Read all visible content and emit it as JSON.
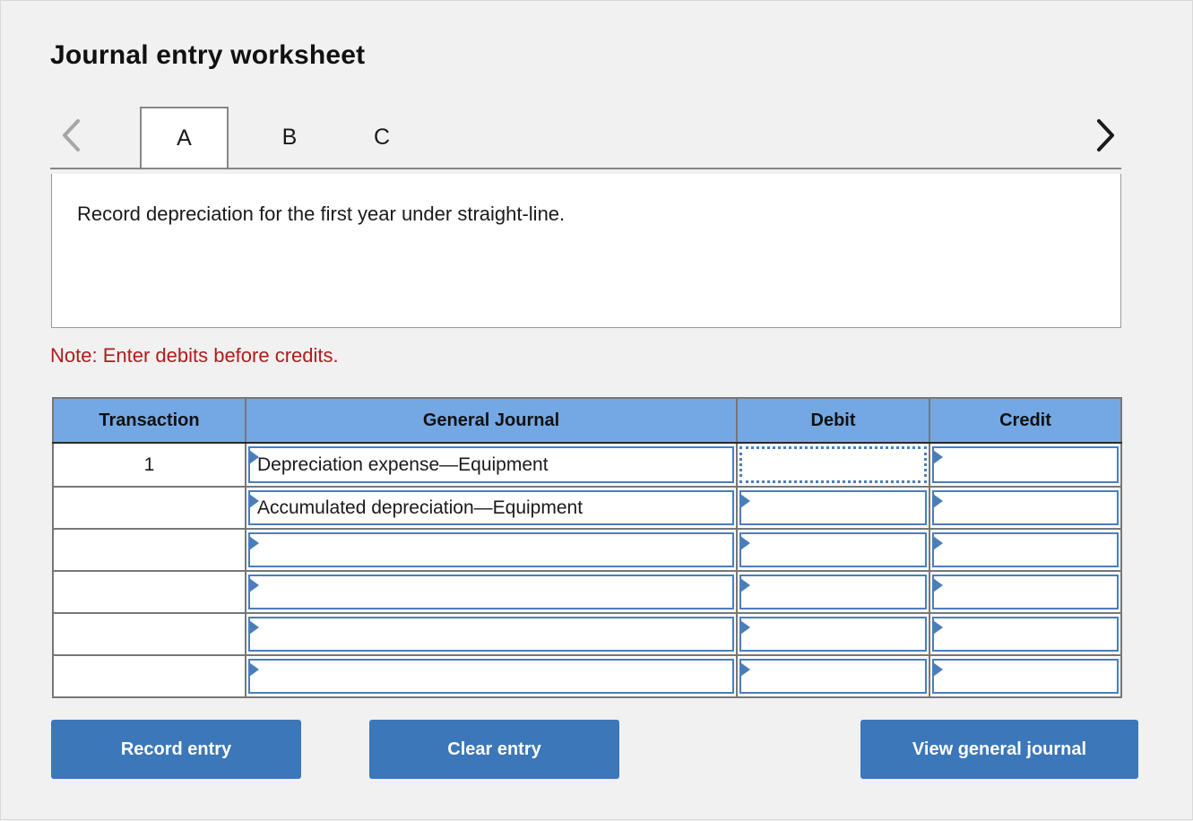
{
  "page": {
    "title": "Journal entry worksheet",
    "background_color": "#f1f1f1"
  },
  "tabs": {
    "prev_label": "‹",
    "next_label": "›",
    "items": [
      {
        "label": "A",
        "active": true
      },
      {
        "label": "B",
        "active": false
      },
      {
        "label": "C",
        "active": false
      }
    ]
  },
  "description": {
    "text": "Record depreciation for the first year under straight-line."
  },
  "note": {
    "text": "Note: Enter debits before credits.",
    "color": "#b11b1b"
  },
  "table": {
    "header_color": "#74a8e4",
    "columns": [
      "Transaction",
      "General Journal",
      "Debit",
      "Credit"
    ],
    "rows": [
      {
        "transaction": "1",
        "general_journal": "Depreciation expense—Equipment",
        "debit": "",
        "credit": "",
        "debit_selected": true
      },
      {
        "transaction": "",
        "general_journal": "Accumulated depreciation—Equipment",
        "debit": "",
        "credit": "",
        "debit_selected": false
      },
      {
        "transaction": "",
        "general_journal": "",
        "debit": "",
        "credit": "",
        "debit_selected": false
      },
      {
        "transaction": "",
        "general_journal": "",
        "debit": "",
        "credit": "",
        "debit_selected": false
      },
      {
        "transaction": "",
        "general_journal": "",
        "debit": "",
        "credit": "",
        "debit_selected": false
      },
      {
        "transaction": "",
        "general_journal": "",
        "debit": "",
        "credit": "",
        "debit_selected": false
      }
    ]
  },
  "buttons": {
    "record": "Record entry",
    "clear": "Clear entry",
    "view": "View general journal",
    "color": "#3b77b9"
  }
}
